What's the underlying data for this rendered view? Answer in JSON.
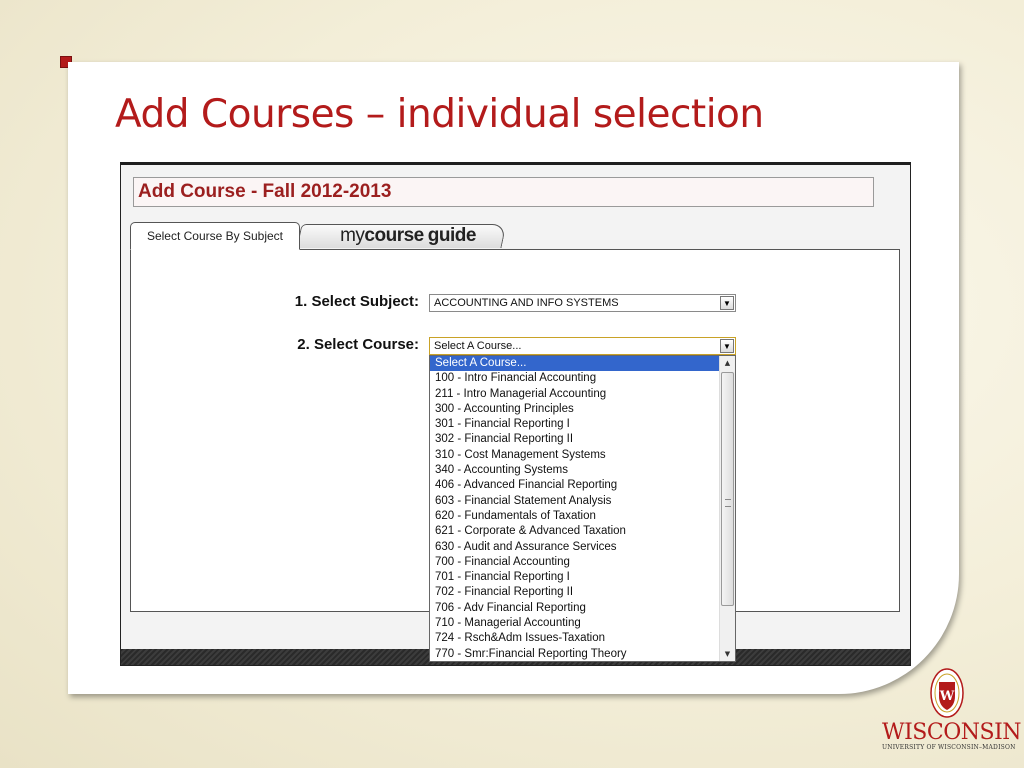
{
  "slide": {
    "title": "Add Courses – individual selection"
  },
  "app": {
    "page_header": "Add Course - Fall 2012-2013",
    "tabs": [
      {
        "label": "Select Course By Subject",
        "active": true
      },
      {
        "label_parts": [
          "my",
          "course",
          "guide"
        ],
        "active": false
      }
    ],
    "form": {
      "subject_label": "1. Select Subject:",
      "subject_value": "ACCOUNTING AND INFO SYSTEMS",
      "course_label": "2. Select Course:",
      "course_value": "Select A Course..."
    },
    "course_options": [
      "Select A Course...",
      "100 - Intro Financial Accounting",
      "211 - Intro Managerial Accounting",
      "300 - Accounting Principles",
      "301 - Financial Reporting I",
      "302 - Financial Reporting II",
      "310 - Cost Management Systems",
      "340 - Accounting Systems",
      "406 - Advanced Financial Reporting",
      "603 - Financial Statement Analysis",
      "620 - Fundamentals of Taxation",
      "621 - Corporate & Advanced Taxation",
      "630 - Audit and Assurance Services",
      "700 - Financial Accounting",
      "701 - Financial Reporting I",
      "702 - Financial Reporting II",
      "706 - Adv Financial Reporting",
      "710 - Managerial Accounting",
      "724 - Rsch&Adm Issues-Taxation",
      "770 - Smr:Financial Reporting Theory"
    ],
    "selected_option_index": 0
  },
  "branding": {
    "name": "WISCONSIN",
    "subtitle": "UNIVERSITY OF WISCONSIN–MADISON",
    "crest_letter": "W"
  },
  "colors": {
    "accent": "#b31b1b",
    "selection": "#3366cc"
  }
}
